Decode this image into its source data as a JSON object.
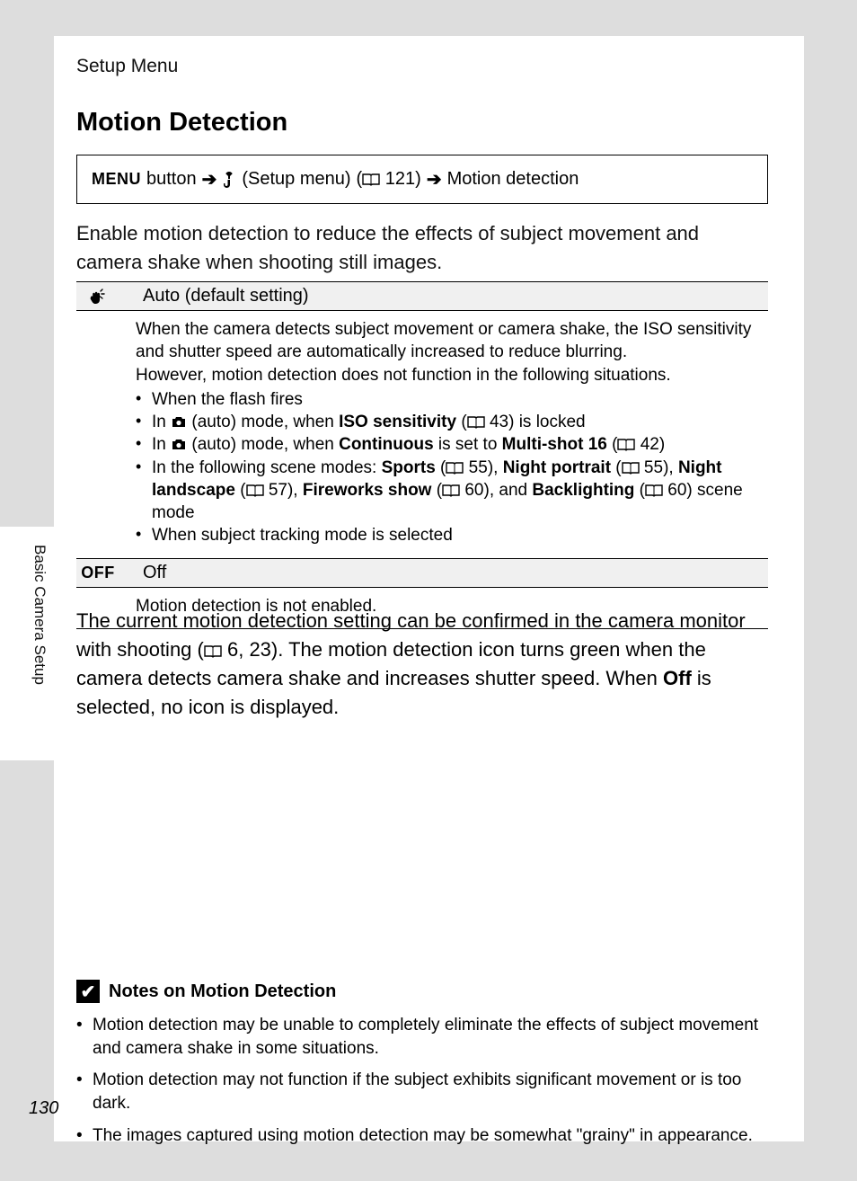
{
  "header": "Setup Menu",
  "title": "Motion Detection",
  "nav": {
    "menu_label": "MENU",
    "button_word": "button",
    "setup_menu": "(Setup menu)",
    "ref1": "121",
    "dest": "Motion detection"
  },
  "intro": "Enable motion detection to reduce the effects of subject movement and camera shake when shooting still images.",
  "options": {
    "auto": {
      "label": "Auto (default setting)",
      "desc1": "When the camera detects subject movement or camera shake, the ISO sensitivity and shutter speed are automatically increased to reduce blurring.",
      "desc2": "However, motion detection does not function in the following situations.",
      "b1": "When the flash fires",
      "b2_pre": "In ",
      "b2_mid": " (auto) mode, when ",
      "b2_iso": "ISO sensitivity",
      "b2_ref": "43",
      "b2_post": ") is locked",
      "b3_pre": "In ",
      "b3_mid": " (auto) mode, when ",
      "b3_cont": "Continuous",
      "b3_set": " is set to ",
      "b3_multi": "Multi-shot 16",
      "b3_ref": "42",
      "b4_pre": "In the following scene modes: ",
      "b4_sports": "Sports",
      "b4_r1": "55",
      "b4_np": "Night portrait",
      "b4_r2": "55",
      "b4_nl": "Night landscape",
      "b4_r3": "57",
      "b4_fw": "Fireworks show",
      "b4_r4": "60",
      "b4_and": ", and ",
      "b4_bl": "Backlighting",
      "b4_r5": "60",
      "b4_post": ") scene mode",
      "b5": "When subject tracking mode is selected"
    },
    "off": {
      "sym": "OFF",
      "label": "Off",
      "desc": "Motion detection is not enabled."
    }
  },
  "para2": {
    "t1": "The current motion detection setting can be confirmed in the camera monitor with shooting (",
    "ref": "6, 23",
    "t2": "). The motion detection icon turns green when the camera detects camera shake and increases shutter speed. When ",
    "off": "Off",
    "t3": " is selected, no icon is displayed."
  },
  "notes": {
    "heading": "Notes on Motion Detection",
    "n1": "Motion detection may be unable to completely eliminate the effects of subject movement and camera shake in some situations.",
    "n2": "Motion detection may not function if the subject exhibits significant movement or is too dark.",
    "n3": "The images captured using motion detection may be somewhat \"grainy\" in appearance."
  },
  "side_label": "Basic Camera Setup",
  "page_number": "130"
}
